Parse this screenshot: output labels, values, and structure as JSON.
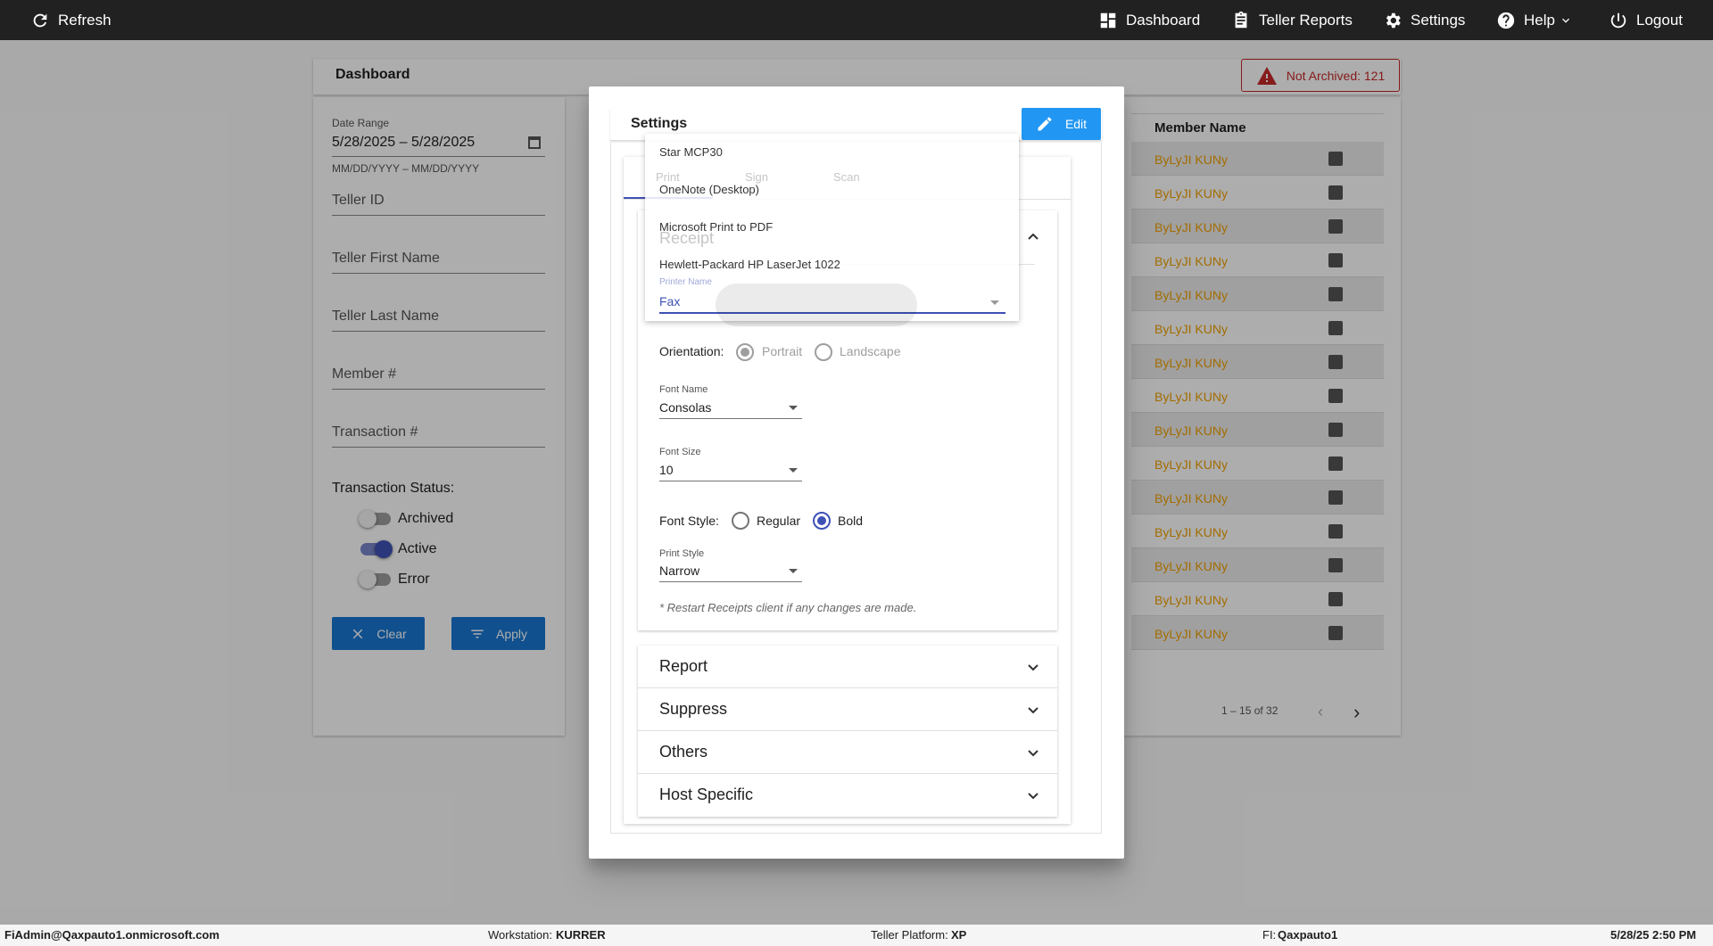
{
  "topbar": {
    "refresh": "Refresh",
    "dashboard": "Dashboard",
    "teller_reports": "Teller Reports",
    "settings": "Settings",
    "help": "Help",
    "logout": "Logout"
  },
  "dashboard": {
    "title": "Dashboard",
    "not_archived": "Not Archived: 121"
  },
  "filters": {
    "date_range_label": "Date Range",
    "date_range_value": "5/28/2025 – 5/28/2025",
    "date_format_hint": "MM/DD/YYYY – MM/DD/YYYY",
    "teller_id": "Teller ID",
    "teller_first_name": "Teller First Name",
    "teller_last_name": "Teller Last Name",
    "member_no": "Member #",
    "transaction_no": "Transaction #",
    "status_label": "Transaction Status:",
    "statuses": [
      {
        "label": "Archived",
        "on": false
      },
      {
        "label": "Active",
        "on": true
      },
      {
        "label": "Error",
        "on": false
      }
    ],
    "clear_label": "Clear",
    "apply_label": "Apply"
  },
  "table": {
    "column_member_name": "Member Name",
    "rows": [
      "ByLyJI KUNy",
      "ByLyJI KUNy",
      "ByLyJI KUNy",
      "ByLyJI KUNy",
      "ByLyJI KUNy",
      "ByLyJI KUNy",
      "ByLyJI KUNy",
      "ByLyJI KUNy",
      "ByLyJI KUNy",
      "ByLyJI KUNy",
      "ByLyJI KUNy",
      "ByLyJI KUNy",
      "ByLyJI KUNy",
      "ByLyJI KUNy",
      "ByLyJI KUNy"
    ],
    "pagination": "1 – 15 of 32"
  },
  "footer": {
    "user": "FiAdmin@Qaxpauto1.onmicrosoft.com",
    "workstation_label": "Workstation:",
    "workstation": "KURRER",
    "platform_label": "Teller Platform:",
    "platform": "XP",
    "fi_label": "FI:",
    "fi": "Qaxpauto1",
    "datetime": "5/28/25 2:50 PM"
  },
  "settings_modal": {
    "title": "Settings",
    "edit_label": "Edit",
    "tabs": [
      "Print",
      "Sign",
      "Scan"
    ],
    "receipt_panel": "Receipt",
    "printer_name_label": "Printer Name",
    "printer_name_value": "Fax",
    "printer_options": [
      "Star MCP30",
      "OneNote (Desktop)",
      "Microsoft Print to PDF",
      "Hewlett-Packard HP LaserJet 1022"
    ],
    "orientation_label": "Orientation:",
    "orientation_options": [
      "Portrait",
      "Landscape"
    ],
    "orientation_selected": "Portrait",
    "font_name_label": "Font Name",
    "font_name_value": "Consolas",
    "font_size_label": "Font Size",
    "font_size_value": "10",
    "font_style_label": "Font Style:",
    "font_style_options": [
      "Regular",
      "Bold"
    ],
    "font_style_selected": "Bold",
    "print_style_label": "Print Style",
    "print_style_value": "Narrow",
    "restart_note": "* Restart Receipts client if any changes are made.",
    "panels": [
      "Report",
      "Suppress",
      "Others",
      "Host Specific"
    ]
  },
  "colors": {
    "topbar": "#212121",
    "accent_blue": "#1976d2",
    "edit_blue": "#2196f3",
    "indigo": "#3f51b5",
    "warning_red": "#c62828",
    "member_name_orange": "#f0a000"
  }
}
